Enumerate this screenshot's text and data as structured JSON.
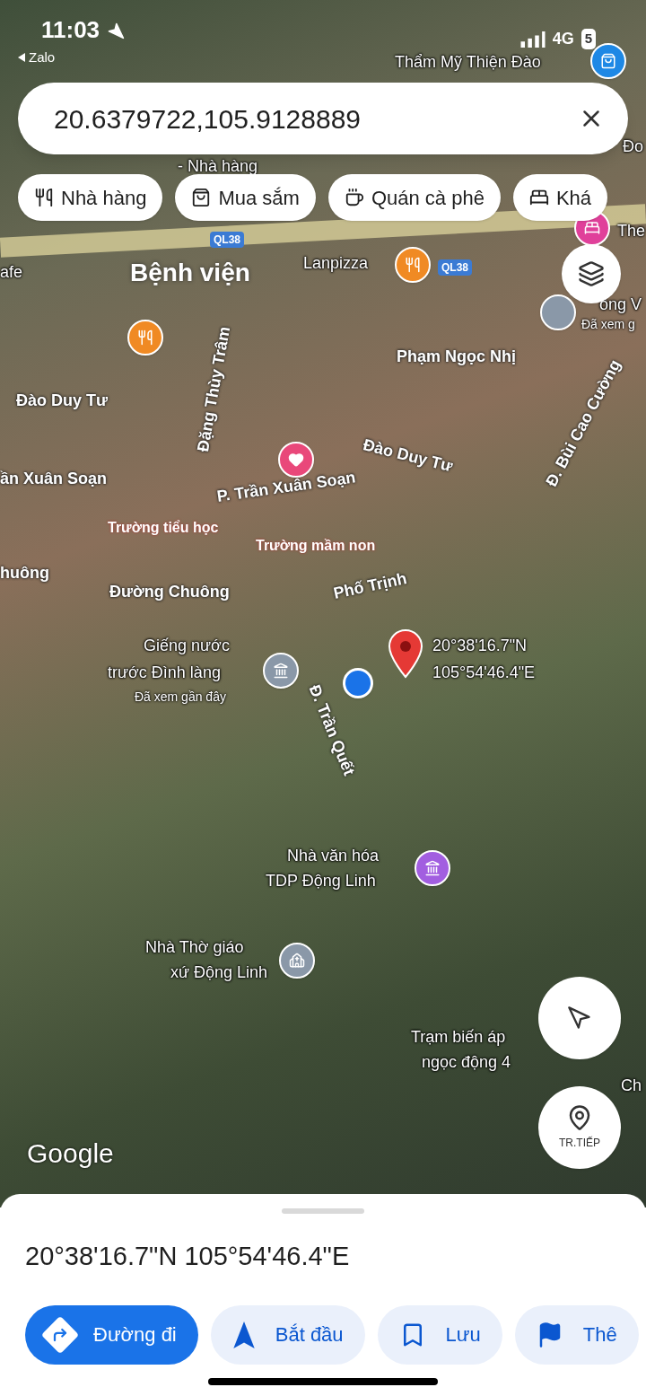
{
  "status_bar": {
    "time": "11:03",
    "back_app": "Zalo",
    "network": "4G",
    "battery": "5"
  },
  "search": {
    "value": "20.6379722,105.9128889"
  },
  "chips": [
    {
      "label": "Nhà hàng",
      "kind": "restaurant"
    },
    {
      "label": "Mua sắm",
      "kind": "shopping"
    },
    {
      "label": "Quán cà phê",
      "kind": "cafe"
    },
    {
      "label": "Khá",
      "kind": "hotel"
    }
  ],
  "map": {
    "labels": [
      {
        "text": "Thẩm Mỹ Thiện Đào",
        "kind": "place"
      },
      {
        "text": "- Nhà hàng",
        "kind": "place"
      },
      {
        "text": "afe",
        "kind": "place"
      },
      {
        "text": "Bệnh viện",
        "kind": "area"
      },
      {
        "text": "Lanpizza",
        "kind": "place"
      },
      {
        "text": "Phạm Ngọc Nhị",
        "kind": "street"
      },
      {
        "text": "Đào Duy Tư",
        "kind": "street"
      },
      {
        "text": "Đặng Thùy Trâm",
        "kind": "street"
      },
      {
        "text": "Đào Duy Tư",
        "kind": "street"
      },
      {
        "text": "Đ. Bùi Cao Cường",
        "kind": "street"
      },
      {
        "text": "ần Xuân Soạn",
        "kind": "street"
      },
      {
        "text": "P. Trần Xuân Soạn",
        "kind": "street"
      },
      {
        "text": "Trường tiểu học",
        "kind": "school"
      },
      {
        "text": "Trường mầm non",
        "kind": "school"
      },
      {
        "text": "huông",
        "kind": "street"
      },
      {
        "text": "Đường Chuông",
        "kind": "street"
      },
      {
        "text": "Phố Trịnh",
        "kind": "street"
      },
      {
        "text": "Giếng nước",
        "kind": "place"
      },
      {
        "text": "trước Đình làng",
        "kind": "place"
      },
      {
        "text": "Đã xem gần đây",
        "kind": "note"
      },
      {
        "text": "20°38'16.7\"N",
        "kind": "place"
      },
      {
        "text": "105°54'46.4\"E",
        "kind": "place"
      },
      {
        "text": "Đ. Trần Quết",
        "kind": "street"
      },
      {
        "text": "Nhà văn hóa",
        "kind": "place"
      },
      {
        "text": "TDP Động Linh",
        "kind": "place"
      },
      {
        "text": "Nhà Thờ giáo",
        "kind": "place"
      },
      {
        "text": "xứ Động Linh",
        "kind": "place"
      },
      {
        "text": "Trạm biến áp",
        "kind": "place"
      },
      {
        "text": "ngọc động 4",
        "kind": "place"
      },
      {
        "text": "QL38",
        "kind": "route"
      },
      {
        "text": "QL38",
        "kind": "route"
      },
      {
        "text": "Đo",
        "kind": "place"
      },
      {
        "text": "The",
        "kind": "place"
      },
      {
        "text": "ông V",
        "kind": "place"
      },
      {
        "text": "Đã xem g",
        "kind": "note"
      },
      {
        "text": "Ch",
        "kind": "place"
      }
    ],
    "pins": [
      {
        "kind": "shopping",
        "color": "#1e88e5"
      },
      {
        "kind": "restaurant",
        "color": "#f08a24"
      },
      {
        "kind": "restaurant",
        "color": "#f08a24"
      },
      {
        "kind": "heart",
        "color": "#e9487a"
      },
      {
        "kind": "hotel",
        "color": "#e0409a"
      },
      {
        "kind": "generic",
        "color": "#8a98a8"
      },
      {
        "kind": "monument",
        "color": "#8a98a8"
      },
      {
        "kind": "dropped",
        "color": "#e53935"
      },
      {
        "kind": "me",
        "color": "#1a73e8"
      },
      {
        "kind": "culture",
        "color": "#a25ee0"
      },
      {
        "kind": "church",
        "color": "#8a98a8"
      }
    ],
    "watermark": "Google",
    "live_view": "TR.TIẾP"
  },
  "sheet": {
    "title": "20°38'16.7\"N 105°54'46.4\"E",
    "actions": [
      {
        "label": "Đường đi",
        "kind": "directions",
        "primary": true
      },
      {
        "label": "Bắt đầu",
        "kind": "start",
        "primary": false
      },
      {
        "label": "Lưu",
        "kind": "save",
        "primary": false
      },
      {
        "label": "Thê",
        "kind": "flag",
        "primary": false
      }
    ]
  }
}
